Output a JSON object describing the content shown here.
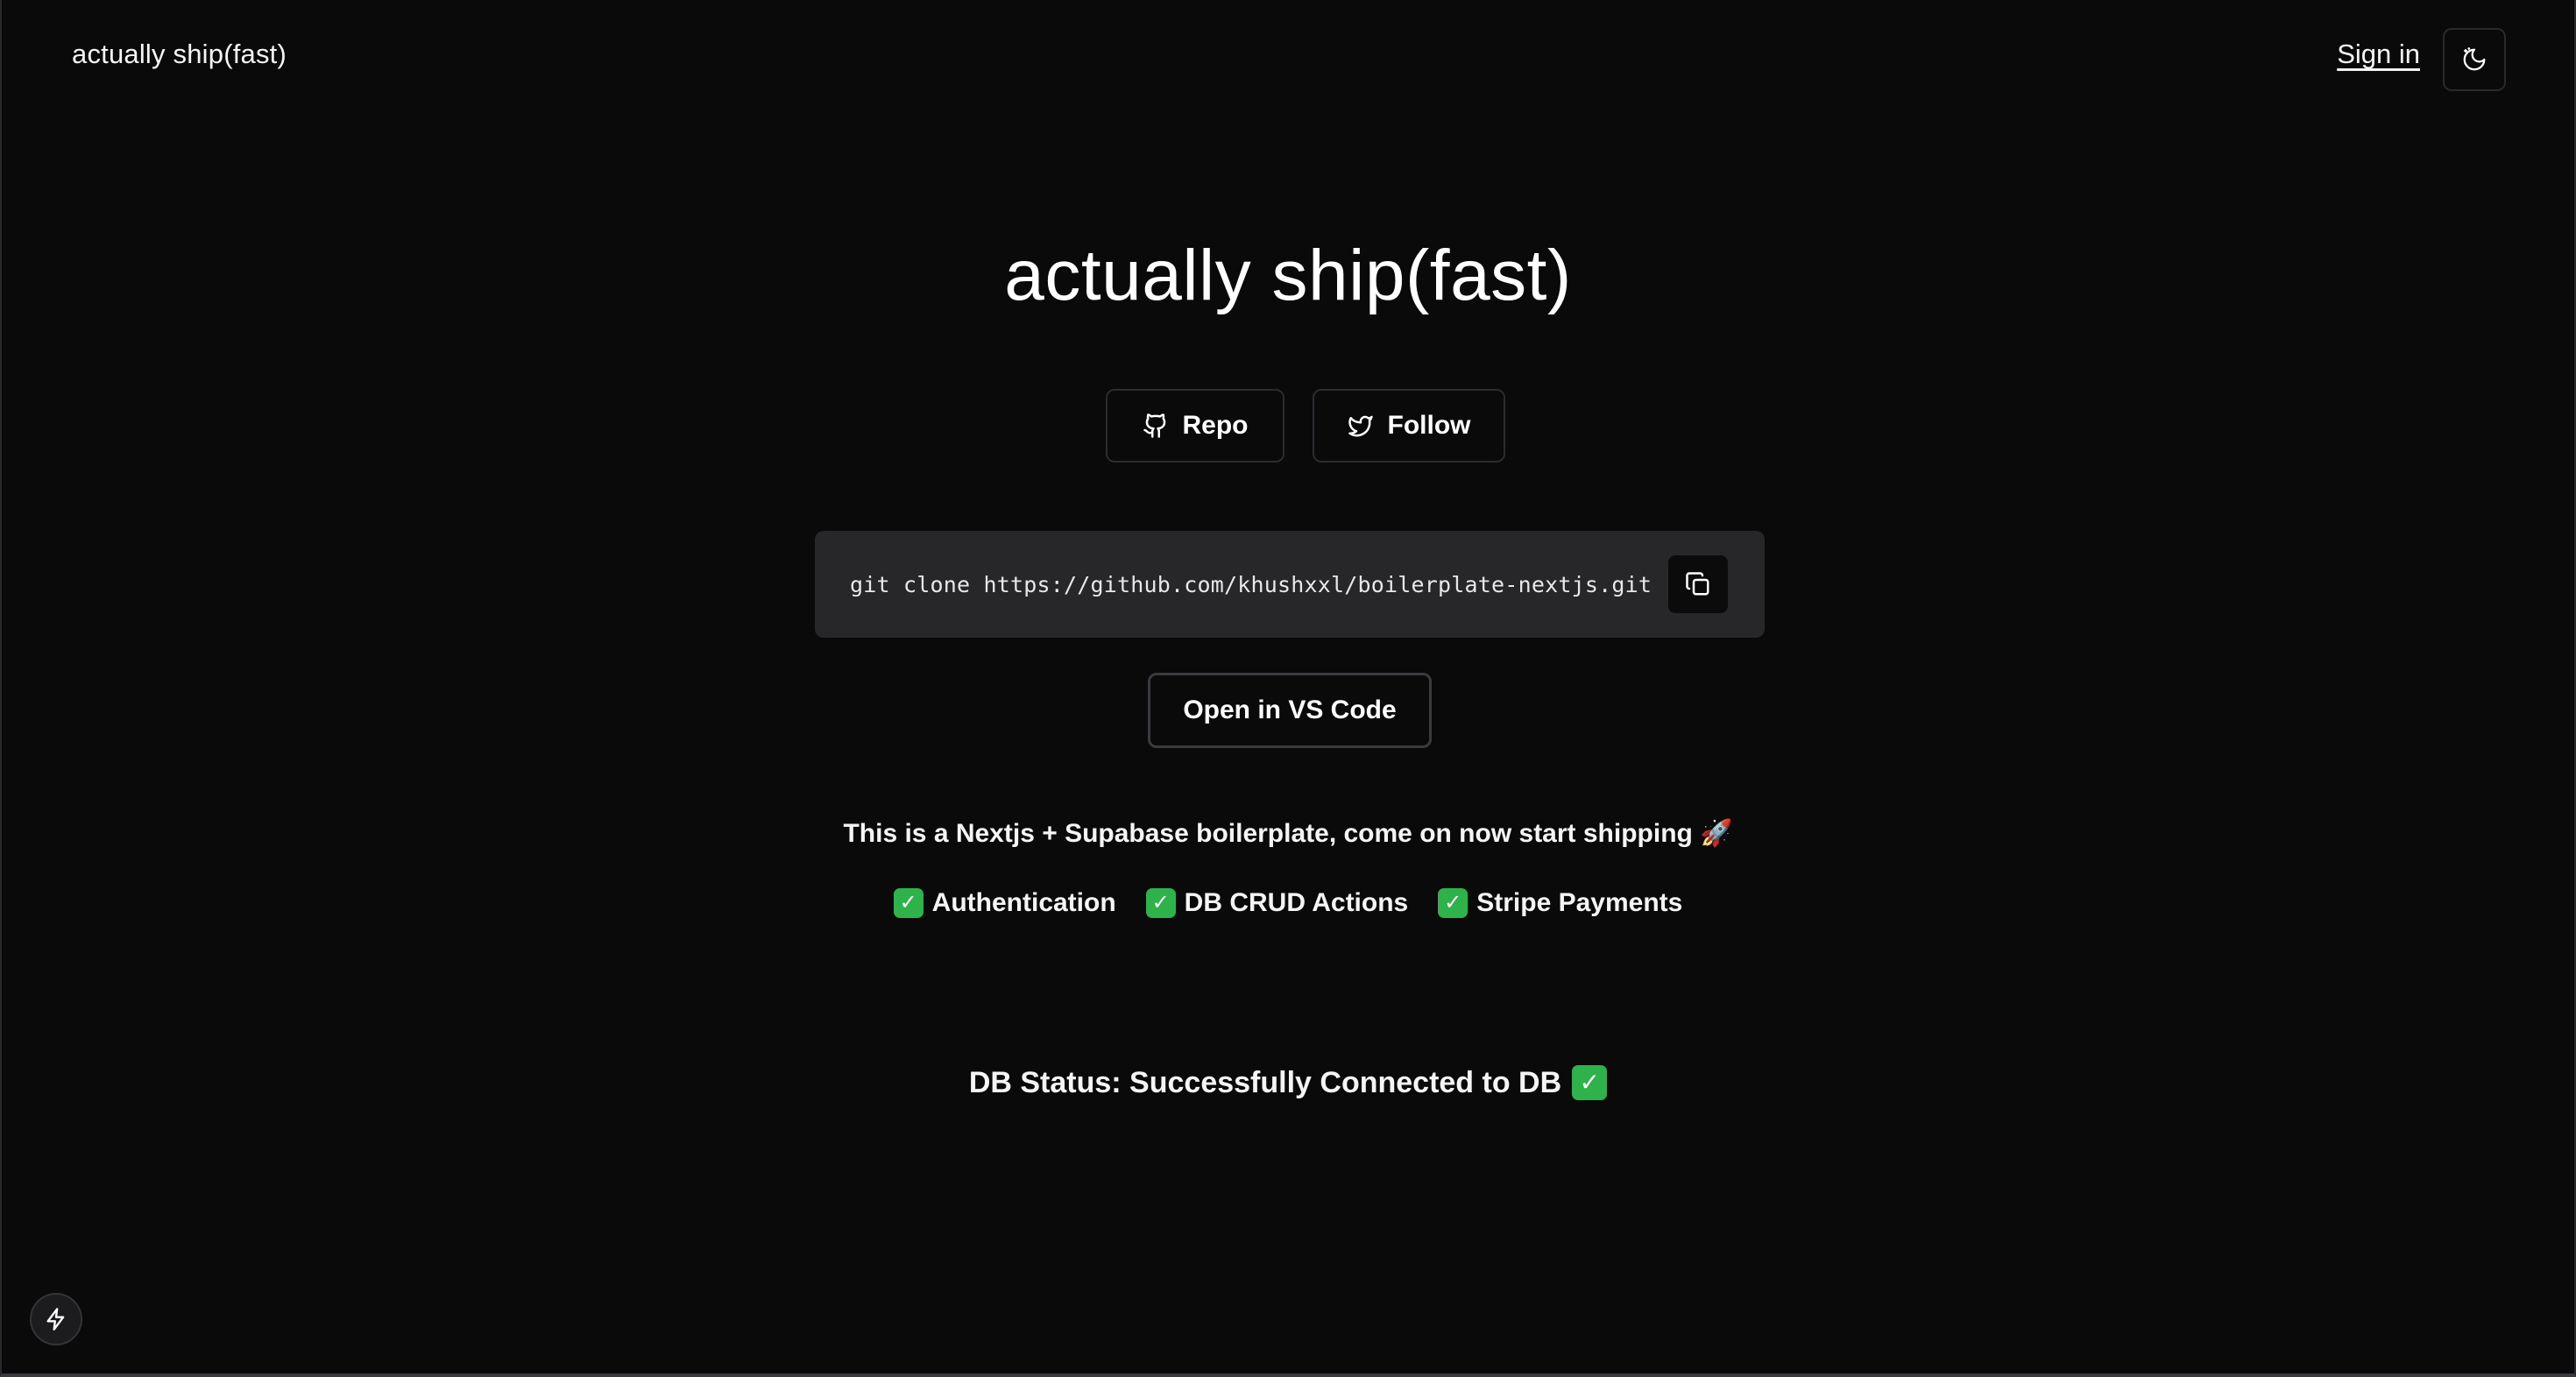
{
  "header": {
    "brand": "actually ship(fast)",
    "sign_in": "Sign in",
    "theme_icon": "moon-sparkle-icon"
  },
  "hero": {
    "title": "actually ship(fast)",
    "repo_label": "Repo",
    "repo_icon": "github-icon",
    "follow_label": "Follow",
    "follow_icon": "twitter-icon"
  },
  "clone": {
    "command": "git clone https://github.com/khushxxl/boilerplate-nextjs.git",
    "copy_icon": "copy-icon"
  },
  "vscode": {
    "label": "Open in VS Code"
  },
  "tagline": "This is a Nextjs + Supabase boilerplate, come on now start shipping 🚀",
  "features": [
    {
      "check": "✓",
      "label": "Authentication"
    },
    {
      "check": "✓",
      "label": "DB CRUD Actions"
    },
    {
      "check": "✓",
      "label": "Stripe Payments"
    }
  ],
  "db_status": {
    "label": "DB Status: Successfully Connected to DB",
    "check": "✓"
  },
  "dev_tools": {
    "icon": "lightning-bolt-icon"
  },
  "colors": {
    "background": "#0a0a0b",
    "code_bg": "#27272a",
    "check_green": "#2eb34a"
  }
}
